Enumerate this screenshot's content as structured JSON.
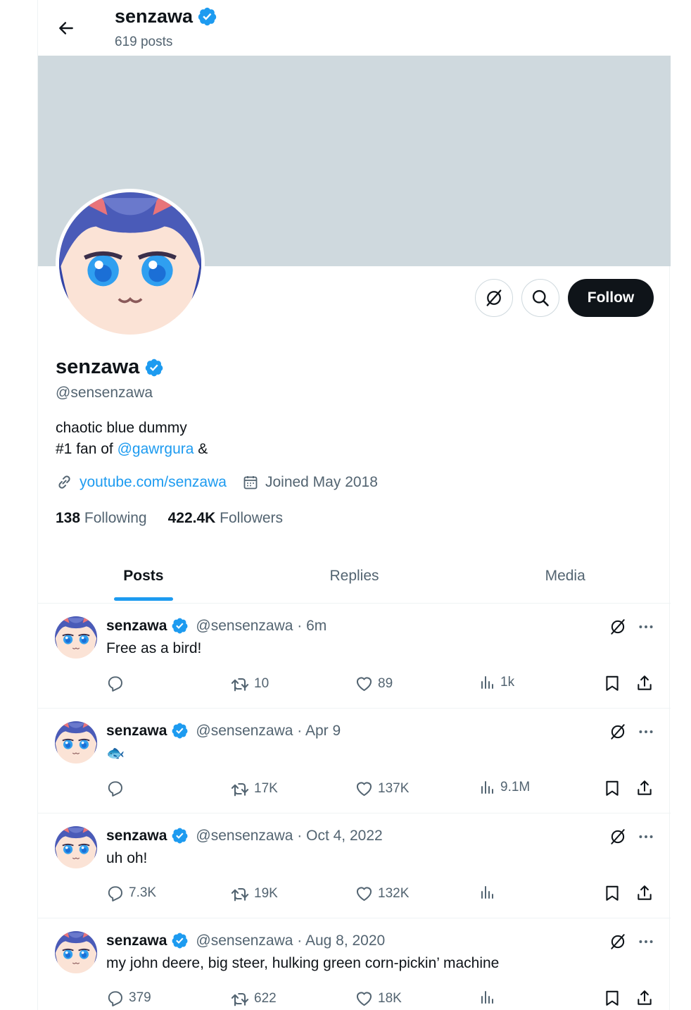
{
  "header": {
    "name": "senzawa",
    "post_count": "619 posts"
  },
  "profile": {
    "name": "senzawa",
    "handle": "@sensenzawa",
    "bio_line1": "chaotic blue dummy",
    "bio_line2_prefix": "#1 fan of ",
    "bio_mention": "@gawrgura",
    "bio_line2_suffix": " &",
    "website": "youtube.com/senzawa",
    "joined": "Joined May 2018",
    "following_count": "138",
    "following_label": "Following",
    "followers_count": "422.4K",
    "followers_label": "Followers",
    "follow_button": "Follow"
  },
  "tabs": [
    "Posts",
    "Replies",
    "Media"
  ],
  "posts": [
    {
      "name": "senzawa",
      "handle": "@sensenzawa",
      "time": "6m",
      "text": "Free as a bird!",
      "replies": "",
      "reposts": "10",
      "likes": "89",
      "views": "1k"
    },
    {
      "name": "senzawa",
      "handle": "@sensenzawa",
      "time": "Apr 9",
      "text": "🐟",
      "replies": "",
      "reposts": "17K",
      "likes": "137K",
      "views": "9.1M"
    },
    {
      "name": "senzawa",
      "handle": "@sensenzawa",
      "time": "Oct 4, 2022",
      "text": "uh oh!",
      "replies": "7.3K",
      "reposts": "19K",
      "likes": "132K",
      "views": ""
    },
    {
      "name": "senzawa",
      "handle": "@sensenzawa",
      "time": "Aug 8, 2020",
      "text": "my john deere, big steer, hulking green corn-pickin’ machine",
      "replies": "379",
      "reposts": "622",
      "likes": "18K",
      "views": ""
    }
  ],
  "colors": {
    "accent": "#1d9bf0",
    "text": "#0f1419",
    "muted": "#536471",
    "banner": "#cfd9de"
  },
  "icons": [
    "back-arrow-icon",
    "verified-badge-icon",
    "grok-icon",
    "search-icon",
    "link-icon",
    "calendar-icon",
    "reply-icon",
    "repost-icon",
    "like-icon",
    "views-icon",
    "bookmark-icon",
    "share-icon",
    "more-icon"
  ]
}
